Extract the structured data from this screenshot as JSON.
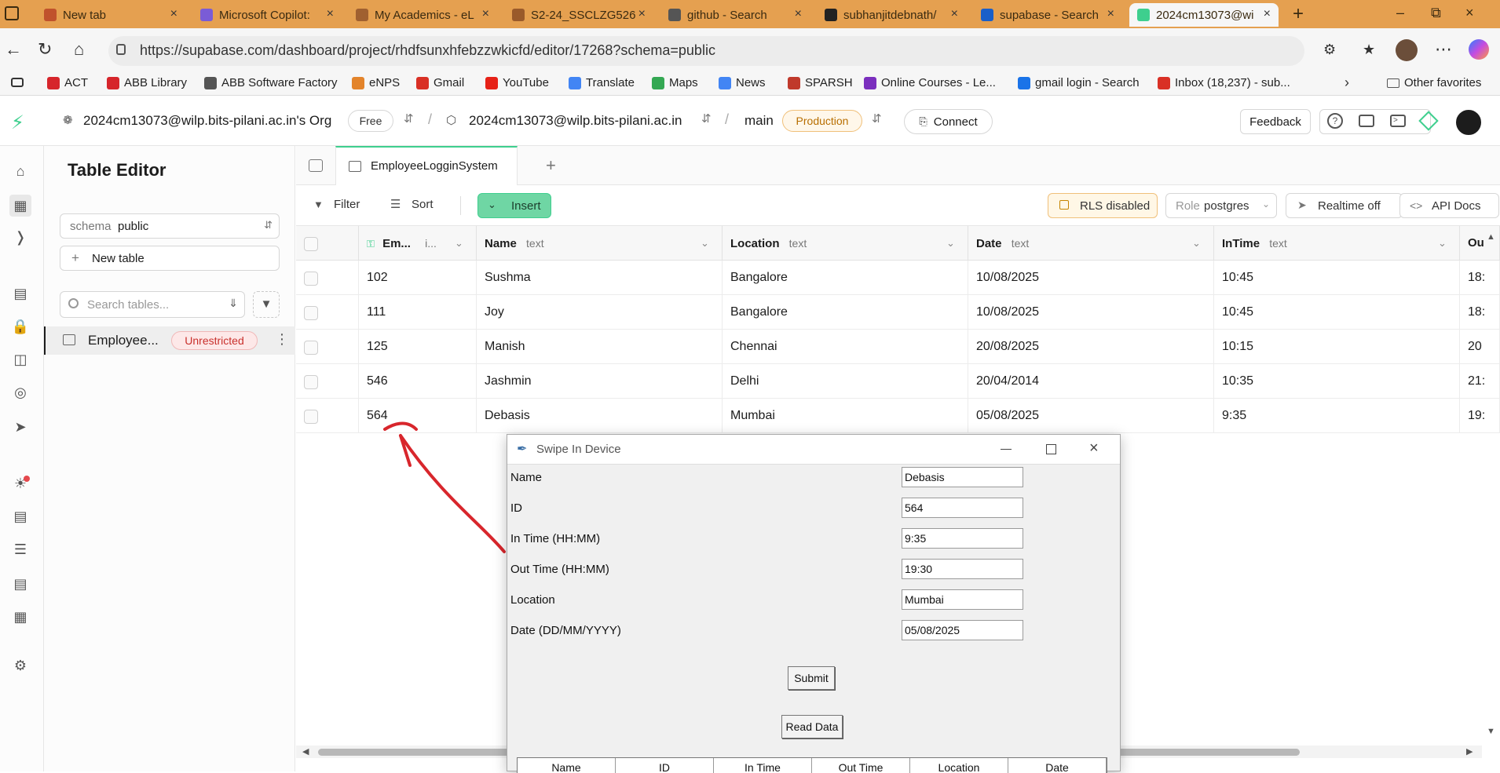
{
  "browser": {
    "tabs": [
      {
        "title": "New tab",
        "icon": "newtab-icon",
        "color": "#c0522c"
      },
      {
        "title": "Microsoft Copilot:",
        "icon": "copilot-icon",
        "color": "#7a5cd6"
      },
      {
        "title": "My Academics - eL",
        "icon": "academics-icon",
        "color": "#a06030"
      },
      {
        "title": "S2-24_SSCLZG526",
        "icon": "course-icon",
        "color": "#9a5a2a"
      },
      {
        "title": "github - Search",
        "icon": "search-icon",
        "color": "#555555"
      },
      {
        "title": "subhanjitdebnath/",
        "icon": "github-icon",
        "color": "#222222"
      },
      {
        "title": "supabase - Search",
        "icon": "search-icon",
        "color": "#1a5fc9"
      },
      {
        "title": "2024cm13073@wi",
        "icon": "supabase-icon",
        "color": "#3ecf8e"
      }
    ],
    "url": "https://supabase.com/dashboard/project/rhdfsunxhfebzzwkicfd/editor/17268?schema=public",
    "bookmarks": [
      {
        "label": "ACT",
        "color": "#d6252b"
      },
      {
        "label": "ABB Library",
        "color": "#d6252b"
      },
      {
        "label": "ABB Software Factory",
        "color": "#555555"
      },
      {
        "label": "eNPS",
        "color": "#e3842b"
      },
      {
        "label": "Gmail",
        "color": "#d93025"
      },
      {
        "label": "YouTube",
        "color": "#e62117"
      },
      {
        "label": "Translate",
        "color": "#4285f4"
      },
      {
        "label": "Maps",
        "color": "#34a853"
      },
      {
        "label": "News",
        "color": "#4285f4"
      },
      {
        "label": "SPARSH",
        "color": "#c0392b"
      },
      {
        "label": "Online Courses - Le...",
        "color": "#7b2fbe"
      },
      {
        "label": "gmail login - Search",
        "color": "#1a73e8"
      },
      {
        "label": "Inbox (18,237) - sub...",
        "color": "#d93025"
      }
    ],
    "other_favorites": "Other favorites"
  },
  "header": {
    "org": "2024cm13073@wilp.bits-pilani.ac.in's Org",
    "plan": "Free",
    "project": "2024cm13073@wilp.bits-pilani.ac.in",
    "branch": "main",
    "env": "Production",
    "connect": "Connect",
    "feedback": "Feedback"
  },
  "sidebar": {
    "title": "Table Editor",
    "schema_label": "schema",
    "schema_value": "public",
    "new_table": "New table",
    "search_placeholder": "Search tables...",
    "table_name": "Employee...",
    "table_badge": "Unrestricted"
  },
  "editor": {
    "tab_label": "EmployeeLogginSystem",
    "filter": "Filter",
    "sort": "Sort",
    "insert": "Insert",
    "rls": "RLS disabled",
    "role_label": "Role",
    "role_value": "postgres",
    "realtime": "Realtime off",
    "api_docs": "API Docs",
    "columns": [
      {
        "name": "Em...",
        "type": "i..."
      },
      {
        "name": "Name",
        "type": "text"
      },
      {
        "name": "Location",
        "type": "text"
      },
      {
        "name": "Date",
        "type": "text"
      },
      {
        "name": "InTime",
        "type": "text"
      },
      {
        "name": "Ou",
        "type": ""
      }
    ],
    "rows": [
      [
        "102",
        "Sushma",
        "Bangalore",
        "10/08/2025",
        "10:45",
        "18:"
      ],
      [
        "111",
        "Joy",
        "Bangalore",
        "10/08/2025",
        "10:45",
        "18:"
      ],
      [
        "125",
        "Manish",
        "Chennai",
        "20/08/2025",
        "10:15",
        "20"
      ],
      [
        "546",
        "Jashmin",
        "Delhi",
        "20/04/2014",
        "10:35",
        "21:"
      ],
      [
        "564",
        "Debasis",
        "Mumbai",
        "05/08/2025",
        "9:35",
        "19:"
      ]
    ]
  },
  "dialog": {
    "title": "Swipe In Device",
    "fields": [
      {
        "label": "Name",
        "value": "Debasis"
      },
      {
        "label": "ID",
        "value": "564"
      },
      {
        "label": "In Time (HH:MM)",
        "value": "9:35"
      },
      {
        "label": "Out Time (HH:MM)",
        "value": "19:30"
      },
      {
        "label": "Location",
        "value": "Mumbai"
      },
      {
        "label": "Date (DD/MM/YYYY)",
        "value": "05/08/2025"
      }
    ],
    "submit": "Submit",
    "read": "Read Data",
    "table_headers": [
      "Name",
      "ID",
      "In Time",
      "Out Time",
      "Location",
      "Date"
    ]
  }
}
